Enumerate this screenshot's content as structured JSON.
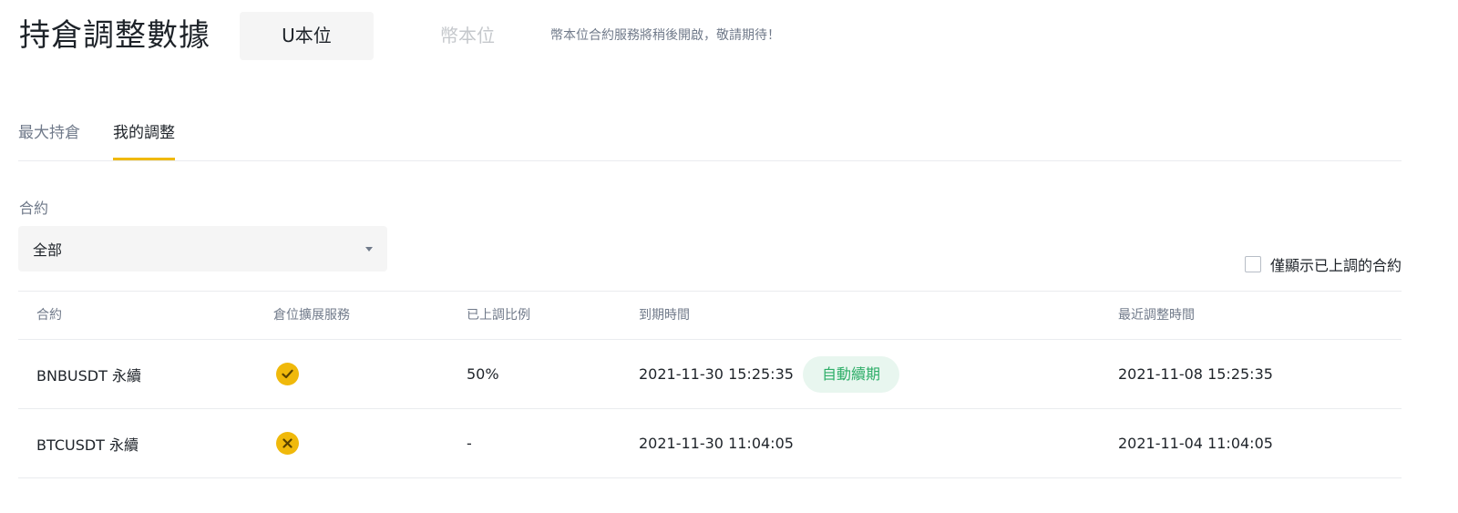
{
  "header": {
    "title": "持倉調整數據",
    "mode_active": "U本位",
    "mode_inactive": "幣本位",
    "notice": "幣本位合約服務將稍後開啟，敬請期待！"
  },
  "tabs": [
    {
      "label": "最大持倉",
      "active": false
    },
    {
      "label": "我的調整",
      "active": true
    }
  ],
  "filter": {
    "label": "合約",
    "selected": "全部"
  },
  "checkbox": {
    "label": "僅顯示已上調的合約",
    "checked": false
  },
  "table": {
    "columns": [
      "合約",
      "倉位擴展服務",
      "已上調比例",
      "到期時間",
      "最近調整時間"
    ],
    "rows": [
      {
        "contract": "BNBUSDT 永續",
        "service_icon": "check-icon",
        "ratio": "50%",
        "expiry": "2021-11-30 15:25:35",
        "badge": "自動續期",
        "last_adjusted": "2021-11-08 15:25:35"
      },
      {
        "contract": "BTCUSDT 永續",
        "service_icon": "close-icon",
        "ratio": "-",
        "expiry": "2021-11-30 11:04:05",
        "badge": "",
        "last_adjusted": "2021-11-04 11:04:05"
      }
    ]
  },
  "colors": {
    "accent": "#f0b90b",
    "badge_bg": "#e8f6ef",
    "badge_text": "#2eae68",
    "muted_text": "#707a8a"
  }
}
